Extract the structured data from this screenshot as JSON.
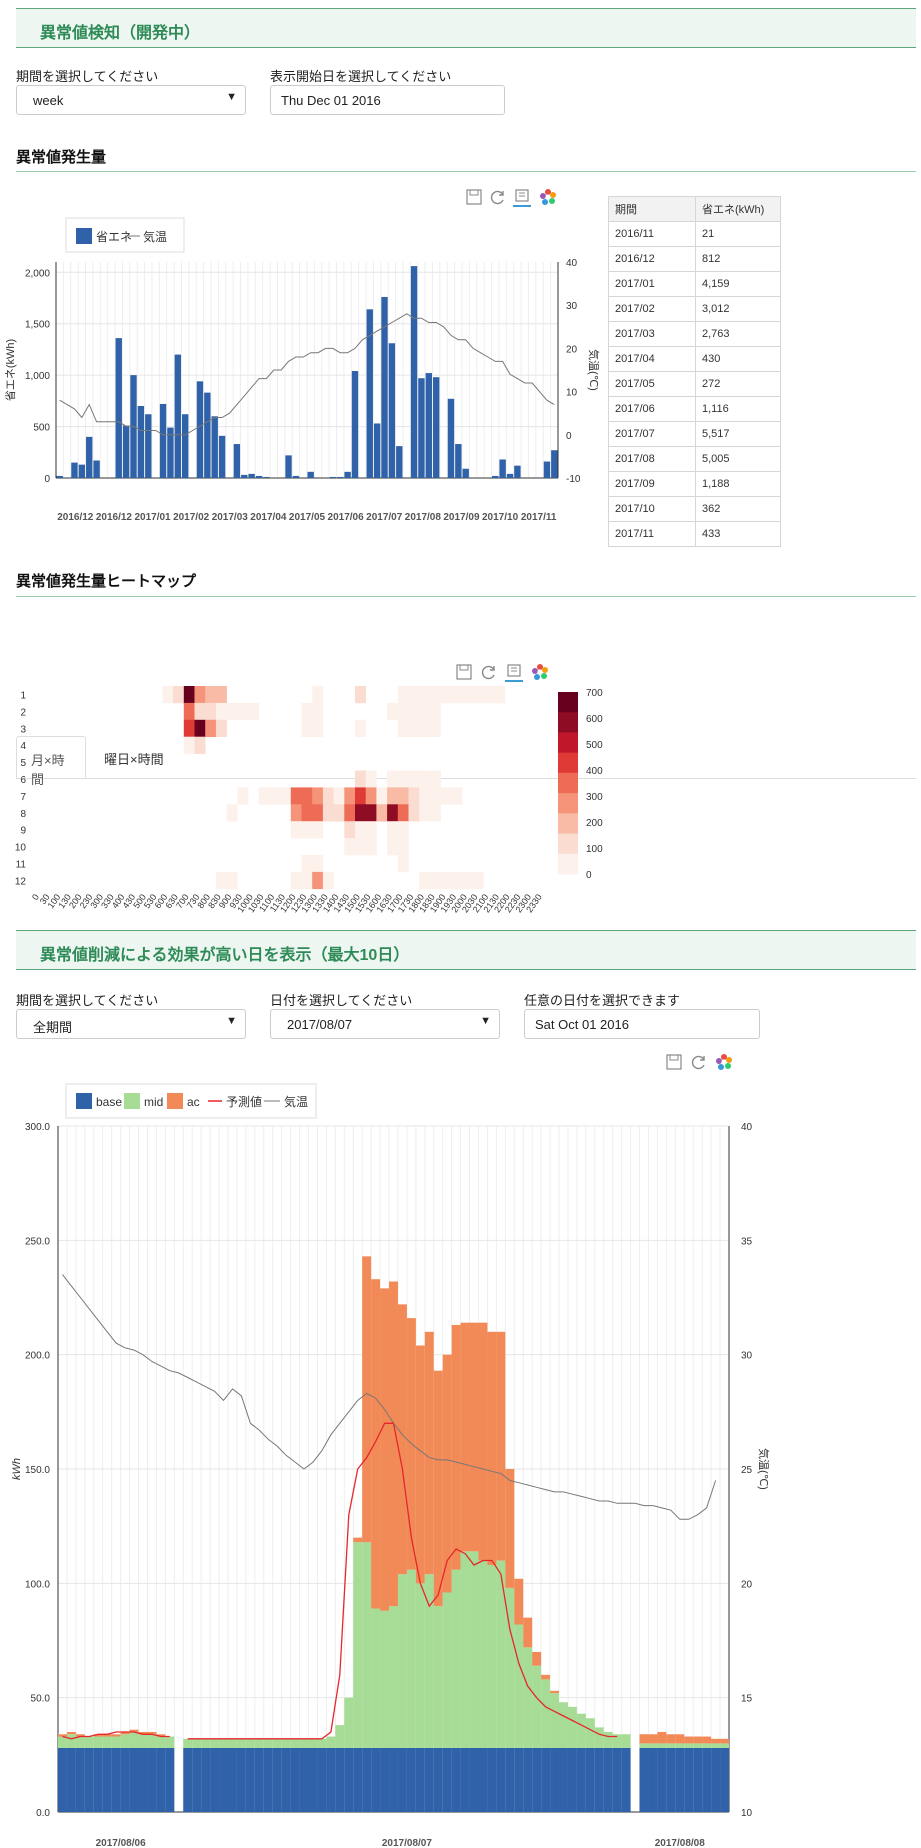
{
  "page": {
    "title1": "異常値検知（開発中）",
    "title2": "異常値削減による効果が高い日を表示（最大10日）"
  },
  "filters1": {
    "period_label": "期間を選択してください",
    "period_value": "week",
    "start_label": "表示開始日を選択してください",
    "start_value": "Thu Dec 01 2016"
  },
  "section_volume": {
    "heading": "異常値発生量"
  },
  "section_heatmap": {
    "heading": "異常値発生量ヒートマップ",
    "tabs": [
      "月×時間",
      "曜日×時間"
    ]
  },
  "filters2": {
    "period_label": "期間を選択してください",
    "period_value": "全期間",
    "date_label": "日付を選択してください",
    "date_value": "2017/08/07",
    "any_label": "任意の日付を選択できます",
    "any_value": "Sat Oct 01 2016"
  },
  "icons": [
    "save-icon",
    "refresh-icon",
    "data-view-icon",
    "color-wheel-icon"
  ],
  "colors": {
    "accent": "#2e8b57",
    "bar": "#2f62a8",
    "line": "#777777",
    "base": "#2f62a8",
    "mid": "#a6dc95",
    "ac": "#f28a57",
    "pred": "#e8262b"
  },
  "month_table": {
    "headers": [
      "期間",
      "省エネ(kWh)"
    ],
    "rows": [
      [
        "2016/11",
        "21"
      ],
      [
        "2016/12",
        "812"
      ],
      [
        "2017/01",
        "4,159"
      ],
      [
        "2017/02",
        "3,012"
      ],
      [
        "2017/03",
        "2,763"
      ],
      [
        "2017/04",
        "430"
      ],
      [
        "2017/05",
        "272"
      ],
      [
        "2017/06",
        "1,116"
      ],
      [
        "2017/07",
        "5,517"
      ],
      [
        "2017/08",
        "5,005"
      ],
      [
        "2017/09",
        "1,188"
      ],
      [
        "2017/10",
        "362"
      ],
      [
        "2017/11",
        "433"
      ]
    ]
  },
  "chart_data": [
    {
      "type": "bar",
      "legend": [
        "省エネ",
        "気温"
      ],
      "ylabel": "省エネ(kWh)",
      "y2label": "気温(℃)",
      "ylim": [
        0,
        2100
      ],
      "y2lim": [
        -10,
        40
      ],
      "yticks": [
        "0",
        "500",
        "1,000",
        "1,500",
        "2,000"
      ],
      "y2ticks": [
        "-10",
        "0",
        "10",
        "20",
        "30",
        "40"
      ],
      "months": [
        "2016/12",
        "2016/12",
        "2017/01",
        "2017/02",
        "2017/03",
        "2017/04",
        "2017/05",
        "2017/06",
        "2017/07",
        "2017/08",
        "2017/09",
        "2017/10",
        "2017/11"
      ],
      "values": [
        20,
        0,
        150,
        130,
        400,
        170,
        0,
        0,
        1360,
        510,
        1000,
        700,
        620,
        0,
        720,
        490,
        1200,
        620,
        0,
        940,
        830,
        600,
        410,
        0,
        330,
        30,
        40,
        20,
        10,
        0,
        0,
        220,
        20,
        0,
        60,
        0,
        0,
        10,
        10,
        60,
        1040,
        0,
        1640,
        530,
        1760,
        1310,
        310,
        0,
        2060,
        970,
        1020,
        980,
        0,
        770,
        330,
        90,
        0,
        0,
        0,
        20,
        180,
        40,
        120,
        0,
        0,
        0,
        160,
        270
      ],
      "temps": [
        8,
        7,
        6,
        4,
        7,
        3,
        3,
        3,
        3,
        2,
        2,
        1,
        1,
        1,
        0,
        0,
        0,
        0,
        1,
        2,
        3,
        4,
        4,
        5,
        7,
        9,
        11,
        13,
        13,
        15,
        15,
        17,
        18,
        18,
        19,
        19,
        20,
        20,
        19,
        19,
        20,
        22,
        23,
        24,
        25,
        26,
        27,
        28,
        27,
        27,
        26,
        26,
        25,
        23,
        22,
        22,
        20,
        19,
        18,
        17,
        17,
        14,
        13,
        12,
        12,
        10,
        8,
        7
      ]
    },
    {
      "type": "heatmap",
      "y": [
        "1",
        "2",
        "3",
        "4",
        "5",
        "6",
        "7",
        "8",
        "9",
        "10",
        "11",
        "12"
      ],
      "x": [
        "0",
        "30",
        "100",
        "130",
        "200",
        "230",
        "300",
        "330",
        "400",
        "430",
        "500",
        "530",
        "600",
        "630",
        "700",
        "730",
        "800",
        "830",
        "900",
        "930",
        "1000",
        "1030",
        "1100",
        "1130",
        "1200",
        "1230",
        "1300",
        "1330",
        "1400",
        "1430",
        "1500",
        "1530",
        "1600",
        "1630",
        "1700",
        "1730",
        "1800",
        "1830",
        "1900",
        "1930",
        "2000",
        "2030",
        "2100",
        "2130",
        "2200",
        "2230",
        "2300",
        "2330"
      ],
      "visual_map": [
        "0",
        "100",
        "200",
        "300",
        "400",
        "500",
        "600",
        "700"
      ],
      "cells": [
        [
          0,
          12,
          60
        ],
        [
          0,
          13,
          140
        ],
        [
          0,
          14,
          730
        ],
        [
          0,
          15,
          260
        ],
        [
          0,
          16,
          180
        ],
        [
          0,
          17,
          200
        ],
        [
          0,
          26,
          60
        ],
        [
          0,
          30,
          150
        ],
        [
          0,
          34,
          30
        ],
        [
          0,
          35,
          30
        ],
        [
          0,
          36,
          30
        ],
        [
          0,
          37,
          30
        ],
        [
          0,
          38,
          30
        ],
        [
          0,
          39,
          30
        ],
        [
          0,
          40,
          20
        ],
        [
          0,
          41,
          20
        ],
        [
          0,
          42,
          20
        ],
        [
          0,
          43,
          20
        ],
        [
          1,
          14,
          360
        ],
        [
          1,
          15,
          160
        ],
        [
          1,
          16,
          140
        ],
        [
          1,
          17,
          80
        ],
        [
          1,
          18,
          20
        ],
        [
          1,
          19,
          20
        ],
        [
          1,
          20,
          20
        ],
        [
          1,
          25,
          20
        ],
        [
          1,
          26,
          20
        ],
        [
          1,
          33,
          60
        ],
        [
          1,
          34,
          30
        ],
        [
          1,
          35,
          30
        ],
        [
          1,
          36,
          30
        ],
        [
          1,
          37,
          30
        ],
        [
          2,
          14,
          420
        ],
        [
          2,
          15,
          700
        ],
        [
          2,
          16,
          300
        ],
        [
          2,
          17,
          140
        ],
        [
          2,
          25,
          20
        ],
        [
          2,
          26,
          80
        ],
        [
          2,
          30,
          30
        ],
        [
          2,
          34,
          30
        ],
        [
          2,
          35,
          30
        ],
        [
          2,
          36,
          30
        ],
        [
          2,
          37,
          30
        ],
        [
          3,
          14,
          40
        ],
        [
          3,
          15,
          90
        ],
        [
          5,
          30,
          120
        ],
        [
          5,
          31,
          60
        ],
        [
          5,
          33,
          80
        ],
        [
          5,
          34,
          30
        ],
        [
          5,
          35,
          30
        ],
        [
          5,
          36,
          30
        ],
        [
          5,
          37,
          30
        ],
        [
          6,
          19,
          20
        ],
        [
          6,
          21,
          40
        ],
        [
          6,
          22,
          40
        ],
        [
          6,
          23,
          50
        ],
        [
          6,
          24,
          380
        ],
        [
          6,
          25,
          400
        ],
        [
          6,
          26,
          300
        ],
        [
          6,
          27,
          100
        ],
        [
          6,
          28,
          80
        ],
        [
          6,
          29,
          300
        ],
        [
          6,
          30,
          420
        ],
        [
          6,
          31,
          260
        ],
        [
          6,
          32,
          40
        ],
        [
          6,
          33,
          200
        ],
        [
          6,
          34,
          240
        ],
        [
          6,
          35,
          160
        ],
        [
          6,
          36,
          60
        ],
        [
          6,
          37,
          80
        ],
        [
          6,
          38,
          60
        ],
        [
          6,
          39,
          20
        ],
        [
          7,
          18,
          20
        ],
        [
          7,
          24,
          260
        ],
        [
          7,
          25,
          400
        ],
        [
          7,
          26,
          380
        ],
        [
          7,
          27,
          100
        ],
        [
          7,
          28,
          140
        ],
        [
          7,
          29,
          380
        ],
        [
          7,
          30,
          620
        ],
        [
          7,
          31,
          580
        ],
        [
          7,
          32,
          240
        ],
        [
          7,
          33,
          620
        ],
        [
          7,
          34,
          380
        ],
        [
          7,
          35,
          100
        ],
        [
          7,
          36,
          60
        ],
        [
          7,
          37,
          60
        ],
        [
          8,
          24,
          40
        ],
        [
          8,
          25,
          50
        ],
        [
          8,
          26,
          50
        ],
        [
          8,
          29,
          90
        ],
        [
          8,
          30,
          60
        ],
        [
          8,
          31,
          60
        ],
        [
          8,
          33,
          60
        ],
        [
          8,
          34,
          60
        ],
        [
          9,
          29,
          60
        ],
        [
          9,
          30,
          60
        ],
        [
          9,
          31,
          60
        ],
        [
          9,
          33,
          60
        ],
        [
          9,
          34,
          60
        ],
        [
          10,
          25,
          60
        ],
        [
          10,
          26,
          40
        ],
        [
          10,
          34,
          40
        ],
        [
          11,
          17,
          40
        ],
        [
          11,
          18,
          60
        ],
        [
          11,
          24,
          40
        ],
        [
          11,
          25,
          70
        ],
        [
          11,
          26,
          260
        ],
        [
          11,
          27,
          40
        ],
        [
          11,
          36,
          40
        ],
        [
          11,
          37,
          80
        ],
        [
          11,
          38,
          40
        ],
        [
          11,
          39,
          30
        ],
        [
          11,
          40,
          20
        ],
        [
          11,
          41,
          20
        ]
      ]
    },
    {
      "type": "bar",
      "stacked": true,
      "legend": [
        "base",
        "mid",
        "ac",
        "予測値",
        "気温"
      ],
      "ylabel": "kWh",
      "y2label": "気温(℃)",
      "ylim": [
        0,
        300
      ],
      "y2lim": [
        10,
        40
      ],
      "yticks": [
        "0.0",
        "50.0",
        "100.0",
        "150.0",
        "200.0",
        "250.0",
        "300.0"
      ],
      "y2ticks": [
        "10",
        "15",
        "20",
        "25",
        "30",
        "35",
        "40"
      ],
      "day_labels": [
        "2017/08/06",
        "2017/08/07",
        "2017/08/08"
      ],
      "base": 28,
      "totals": [
        34,
        35,
        34,
        33,
        34,
        34,
        34,
        35,
        36,
        35,
        35,
        34,
        33,
        0,
        32,
        32,
        32,
        32,
        32,
        32,
        32,
        32,
        32,
        32,
        32,
        32,
        32,
        32,
        32,
        32,
        33,
        38,
        50,
        120,
        243,
        233,
        229,
        232,
        222,
        216,
        204,
        210,
        193,
        200,
        213,
        214,
        214,
        214,
        210,
        210,
        150,
        102,
        85,
        70,
        60,
        53,
        47,
        45,
        42,
        40,
        36,
        35,
        34,
        34,
        0,
        34,
        34,
        35,
        34,
        34,
        33,
        33,
        33,
        32,
        32
      ],
      "mid_vals": [
        5,
        6,
        5,
        5,
        5,
        5,
        5,
        6,
        7,
        6,
        6,
        5,
        5,
        0,
        4,
        4,
        4,
        4,
        4,
        4,
        4,
        4,
        4,
        4,
        4,
        4,
        4,
        4,
        4,
        4,
        5,
        10,
        22,
        90,
        90,
        61,
        60,
        62,
        76,
        78,
        72,
        76,
        62,
        68,
        78,
        86,
        86,
        82,
        80,
        82,
        70,
        54,
        44,
        36,
        30,
        24,
        20,
        18,
        15,
        13,
        9,
        7,
        6,
        6,
        0,
        2,
        2,
        2,
        2,
        2,
        2,
        2,
        2,
        2,
        2
      ],
      "pred": [
        33,
        32,
        33,
        33,
        34,
        34,
        35,
        35,
        35,
        34,
        34,
        33,
        33,
        null,
        32,
        32,
        32,
        32,
        32,
        32,
        32,
        32,
        32,
        32,
        32,
        32,
        32,
        32,
        32,
        32,
        35,
        60,
        130,
        150,
        155,
        162,
        170,
        170,
        150,
        120,
        100,
        90,
        95,
        110,
        115,
        113,
        108,
        110,
        110,
        104,
        80,
        65,
        55,
        50,
        46,
        44,
        42,
        40,
        38,
        36,
        34,
        33,
        33,
        null,
        null,
        null,
        null,
        null,
        null,
        null,
        null,
        null,
        null,
        null
      ],
      "temps": [
        33.5,
        33,
        32.5,
        32,
        31.5,
        31,
        30.5,
        30.3,
        30.2,
        30,
        29.7,
        29.5,
        29.3,
        29.2,
        29,
        28.8,
        28.6,
        28.4,
        28,
        28.5,
        28.2,
        27,
        26.7,
        26.3,
        26,
        25.6,
        25.3,
        25,
        25.3,
        25.8,
        26.5,
        27,
        27.5,
        28,
        28.3,
        28.1,
        27.6,
        27,
        26.5,
        26.1,
        25.8,
        25.5,
        25.4,
        25.4,
        25.3,
        25.2,
        25.1,
        25,
        24.9,
        24.8,
        24.5,
        24.4,
        24.3,
        24.2,
        24.1,
        24,
        24,
        23.9,
        23.8,
        23.7,
        23.6,
        23.6,
        23.5,
        23.5,
        23.5,
        23.4,
        23.4,
        23.3,
        23.2,
        22.8,
        22.8,
        23,
        23.3,
        24.5
      ]
    }
  ]
}
